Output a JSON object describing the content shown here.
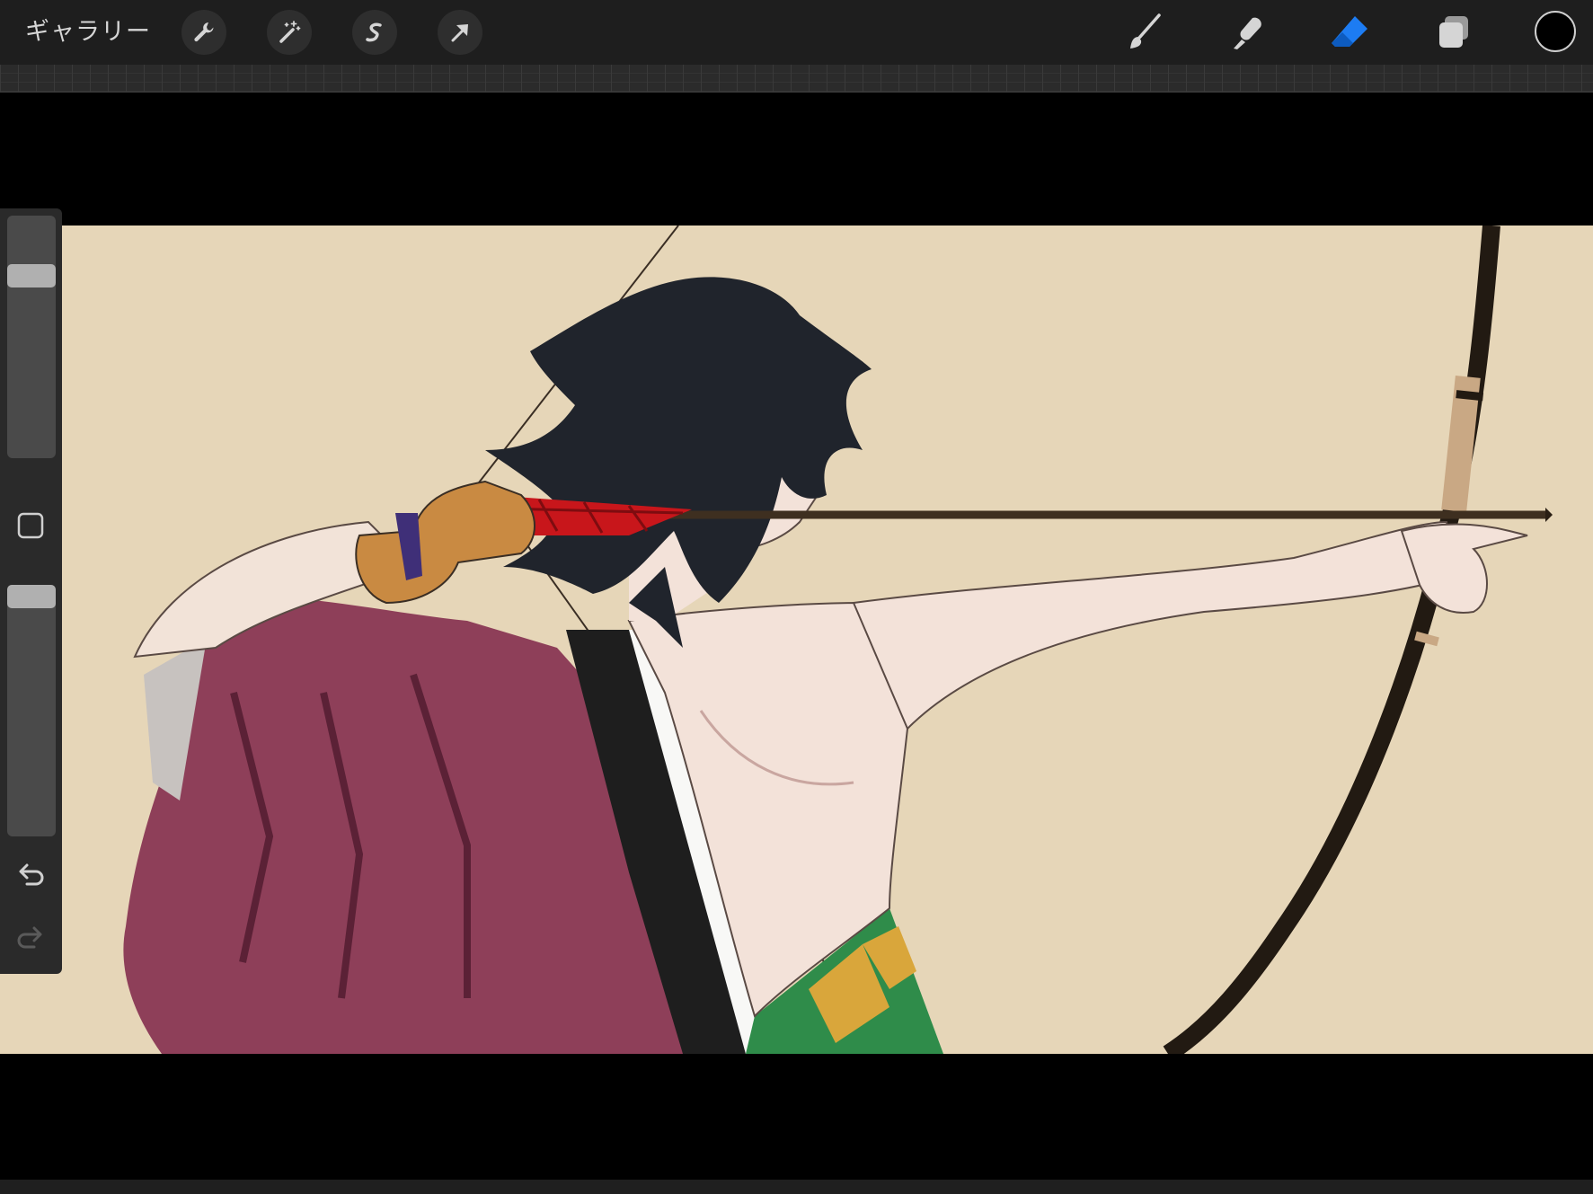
{
  "topbar": {
    "gallery_label": "ギャラリー",
    "left_tools": [
      "wrench-icon",
      "magic-wand-icon",
      "selection-icon",
      "transform-arrow-icon"
    ],
    "right_tools": [
      "brush-icon",
      "smudge-icon",
      "eraser-icon",
      "layers-icon"
    ],
    "active_tool": "eraser",
    "active_color": "#1d7cf2",
    "current_color": "#000000"
  },
  "sidebar": {
    "brush_size_level": 0.78,
    "opacity_level": 1.0,
    "buttons": [
      "modify-square-icon",
      "undo-icon",
      "redo-icon"
    ]
  },
  "canvas": {
    "background_color": "#e6d6b8",
    "artwork": "archer-illustration"
  }
}
